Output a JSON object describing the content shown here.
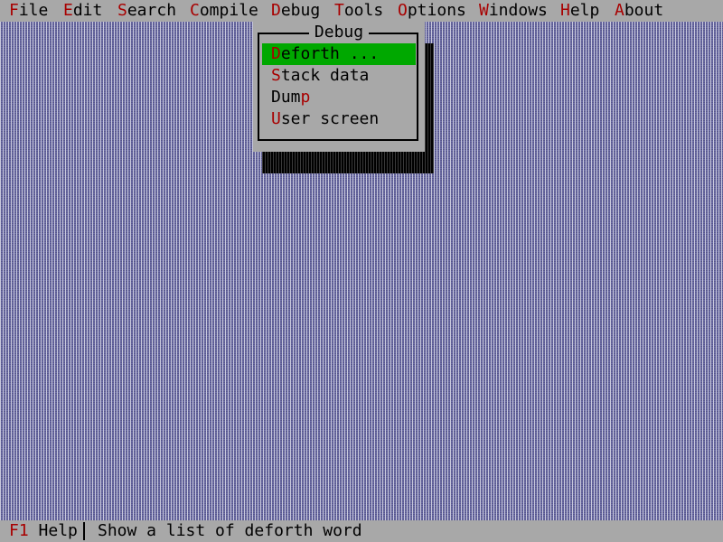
{
  "menubar": {
    "items": [
      {
        "hot": "F",
        "rest": "ile"
      },
      {
        "hot": "E",
        "rest": "dit"
      },
      {
        "hot": "S",
        "rest": "earch"
      },
      {
        "hot": "C",
        "rest": "ompile"
      },
      {
        "hot": "D",
        "rest": "ebug"
      },
      {
        "hot": "T",
        "rest": "ools"
      },
      {
        "hot": "O",
        "rest": "ptions"
      },
      {
        "hot": "W",
        "rest": "indows"
      },
      {
        "hot": "H",
        "rest": "elp"
      },
      {
        "hot": "A",
        "rest": "bout"
      }
    ]
  },
  "dropdown": {
    "title": "Debug",
    "items": [
      {
        "pre": "",
        "hot": "D",
        "post": "eforth ...",
        "selected": true
      },
      {
        "pre": "",
        "hot": "S",
        "post": "tack data",
        "selected": false
      },
      {
        "pre": "Dum",
        "hot": "p",
        "post": "",
        "selected": false
      },
      {
        "pre": "",
        "hot": "U",
        "post": "ser screen",
        "selected": false
      }
    ]
  },
  "statusbar": {
    "key": "F1",
    "key_label": " Help",
    "message": "Show a list of deforth word"
  },
  "colors": {
    "desktop": "#6f6fa8",
    "menu_bg": "#a8a8a8",
    "hotkey": "#a80000",
    "selection": "#00a800"
  }
}
